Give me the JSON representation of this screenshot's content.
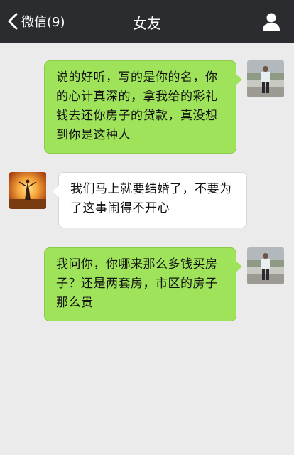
{
  "navbar": {
    "back_label": "微信(9)",
    "title": "女友",
    "back_icon": "chevron-left-icon",
    "profile_icon": "person-icon"
  },
  "messages": [
    {
      "direction": "outgoing",
      "text": "说的好听，写的是你的名，你的心计真深的，拿我给的彩礼钱去还你房子的贷款，真没想到你是这种人"
    },
    {
      "direction": "incoming",
      "text": "我们马上就要结婚了，不要为了这事闹得不开心"
    },
    {
      "direction": "outgoing",
      "text": "我问你，你哪来那么多钱买房子？还是两套房，市区的房子那么贵"
    }
  ],
  "colors": {
    "navbar": "#2b2c30",
    "background": "#ebebeb",
    "outgoing_bubble": "#9fe35a",
    "incoming_bubble": "#ffffff"
  }
}
